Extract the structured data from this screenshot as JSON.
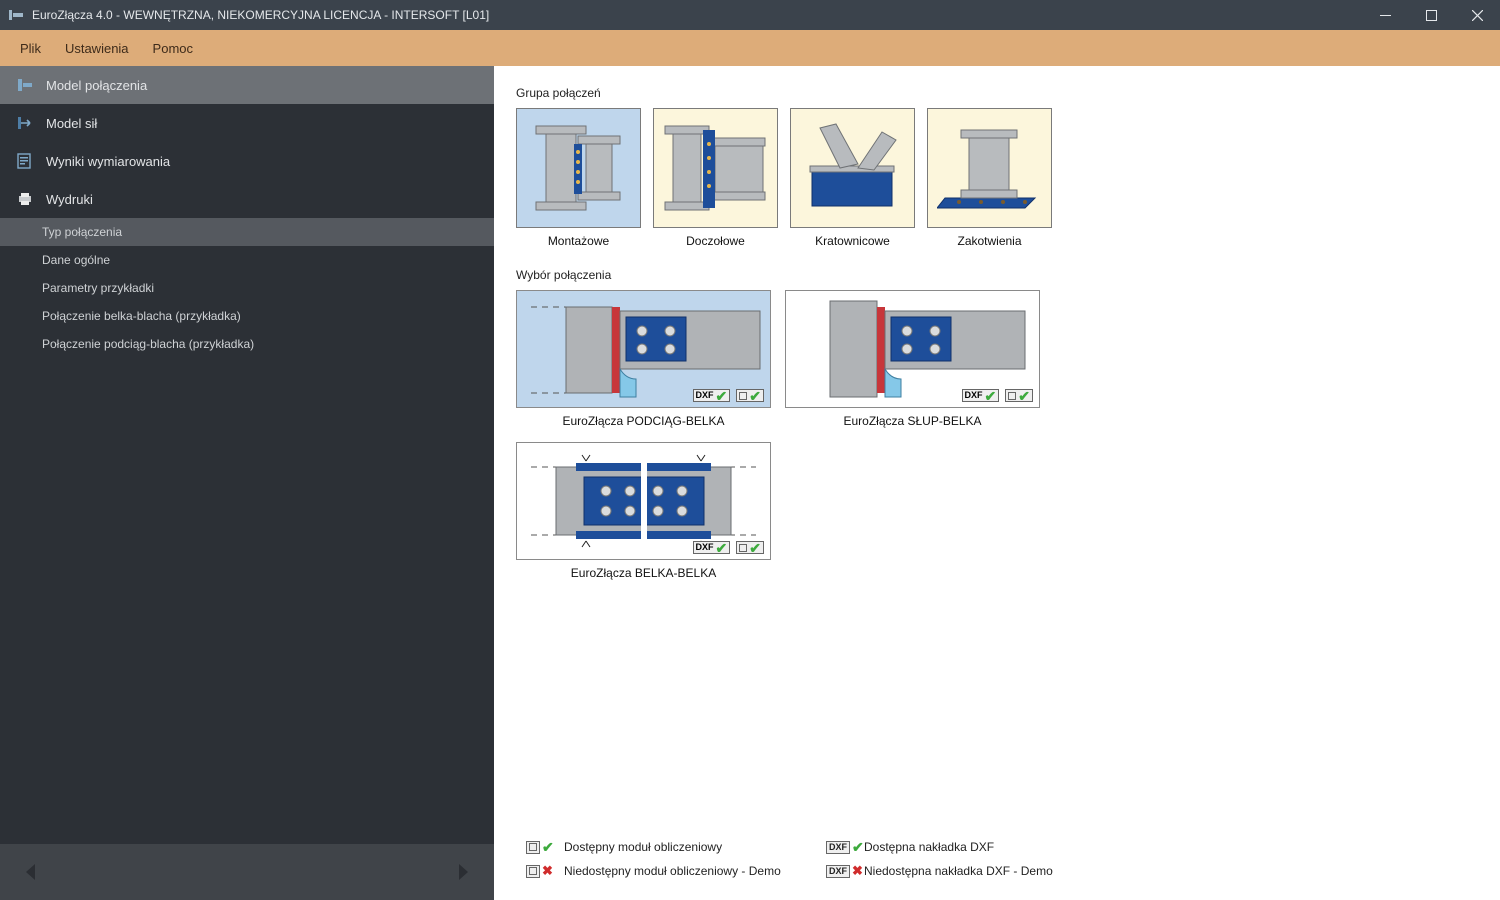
{
  "window": {
    "title": "EuroZłącza 4.0 - WEWNĘTRZNA, NIEKOMERCYJNA LICENCJA - INTERSOFT [L01]"
  },
  "menubar": {
    "items": [
      "Plik",
      "Ustawienia",
      "Pomoc"
    ]
  },
  "sidebar": {
    "primary": [
      {
        "label": "Model połączenia",
        "icon": "joint-model-icon",
        "active": true
      },
      {
        "label": "Model sił",
        "icon": "forces-icon",
        "active": false
      },
      {
        "label": "Wyniki wymiarowania",
        "icon": "results-icon",
        "active": false
      },
      {
        "label": "Wydruki",
        "icon": "printer-icon",
        "active": false
      }
    ],
    "sub": [
      {
        "label": "Typ połączenia",
        "active": true
      },
      {
        "label": "Dane ogólne",
        "active": false
      },
      {
        "label": "Parametry przykładki",
        "active": false
      },
      {
        "label": "Połączenie belka-blacha (przykładka)",
        "active": false
      },
      {
        "label": "Połączenie podciąg-blacha (przykładka)",
        "active": false
      }
    ]
  },
  "main": {
    "group_header": "Grupa połączeń",
    "groups": [
      {
        "label": "Montażowe",
        "selected": true
      },
      {
        "label": "Doczołowe",
        "selected": false
      },
      {
        "label": "Kratownicowe",
        "selected": false
      },
      {
        "label": "Zakotwienia",
        "selected": false
      }
    ],
    "selection_header": "Wybór połączenia",
    "connections": [
      {
        "label": "EuroZłącza PODCIĄG-BELKA",
        "selected": true,
        "dxf_ok": true,
        "calc_ok": true
      },
      {
        "label": "EuroZłącza SŁUP-BELKA",
        "selected": false,
        "dxf_ok": true,
        "calc_ok": true
      },
      {
        "label": "EuroZłącza BELKA-BELKA",
        "selected": false,
        "dxf_ok": true,
        "calc_ok": true
      }
    ],
    "legend": {
      "calc_ok": "Dostępny moduł obliczeniowy",
      "calc_no": "Niedostępny moduł obliczeniowy - Demo",
      "dxf_ok": "Dostępna nakładka DXF",
      "dxf_no": "Niedostępna nakładka DXF - Demo",
      "dxf_badge_text": "DXF"
    }
  }
}
